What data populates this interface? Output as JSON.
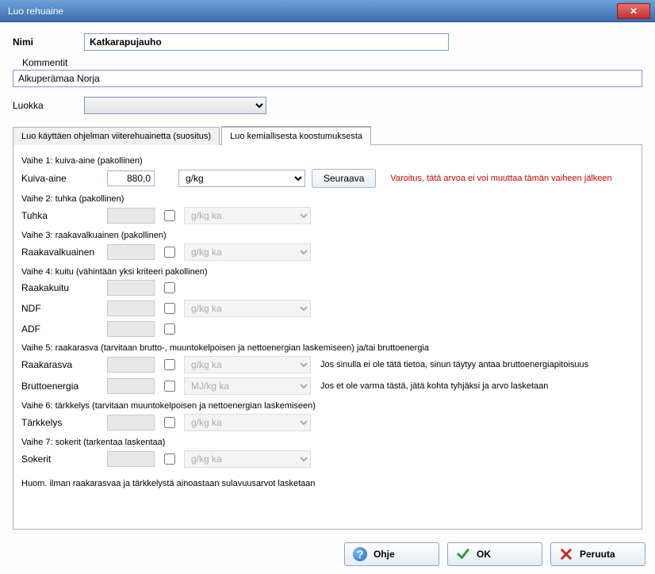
{
  "window": {
    "title": "Luo rehuaine"
  },
  "nimi": {
    "label": "Nimi",
    "value": "Katkarapujauho"
  },
  "kommentit": {
    "label": "Kommentit",
    "value": "Alkuperämaa Norja"
  },
  "luokka": {
    "label": "Luokka",
    "value": ""
  },
  "tabs": {
    "t1": "Luo käyttäen ohjelman viiterehuainetta (suositus)",
    "t2": "Luo kemiallisesta koostumuksesta"
  },
  "stages": {
    "s1": {
      "title": "Vaihe 1: kuiva-aine (pakollinen)",
      "label": "Kuiva-aine",
      "value": "880,0",
      "unit": "g/kg",
      "next": "Seuraava",
      "warning": "Varoitus, tätä arvoa ei voi muuttaa tämän vaiheen jälkeen"
    },
    "s2": {
      "title": "Vaihe 2: tuhka (pakollinen)",
      "label": "Tuhka",
      "unit": "g/kg ka"
    },
    "s3": {
      "title": "Vaihe 3: raakavalkuainen (pakollinen)",
      "label": "Raakavalkuainen",
      "unit": "g/kg ka"
    },
    "s4": {
      "title": "Vaihe 4: kuitu (vähintään yksi kriteeri pakollinen)",
      "l1": "Raakakuitu",
      "l2": "NDF",
      "l3": "ADF",
      "unit": "g/kg ka"
    },
    "s5": {
      "title": "Vaihe 5: raakarasva (tarvitaan brutto-, muuntokelpoisen ja nettoenergian laskemiseen) ja/tai bruttoenergia",
      "l1": "Raakarasva",
      "l2": "Bruttoenergia",
      "u1": "g/kg ka",
      "u2": "MJ/kg ka",
      "info1": "Jos sinulla ei ole tätä tietoa, sinun täytyy antaa bruttoenergiapitoisuus",
      "info2": "Jos et ole varma tästä, jätä kohta tyhjäksi ja arvo lasketaan"
    },
    "s6": {
      "title": "Vaihe 6: tärkkelys (tarvitaan muuntokelpoisen ja nettoenergian laskemiseen)",
      "label": "Tärkkelys",
      "unit": "g/kg ka"
    },
    "s7": {
      "title": "Vaihe 7: sokerit (tarkentaa laskentaa)",
      "label": "Sokerit",
      "unit": "g/kg ka"
    },
    "note": "Huom. ilman raakarasvaa ja tärkkelystä ainoastaan sulavuusarvot lasketaan"
  },
  "buttons": {
    "help": "Ohje",
    "ok": "OK",
    "cancel": "Peruuta"
  }
}
